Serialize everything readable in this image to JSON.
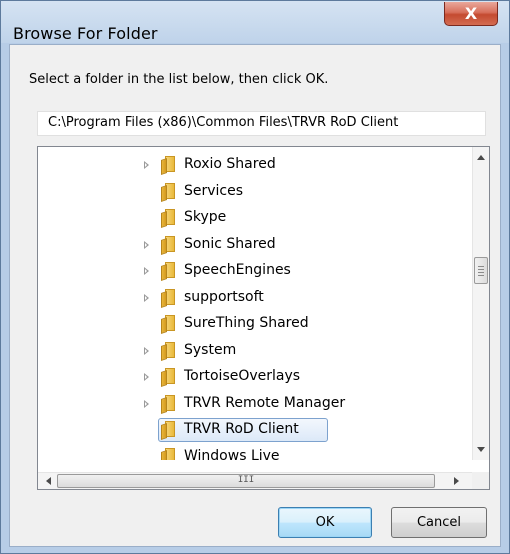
{
  "window": {
    "title": "Browse For Folder",
    "close_glyph": "X"
  },
  "instruction": "Select a folder in the list below, then click OK.",
  "path": "C:\\Program Files (x86)\\Common Files\\TRVR RoD Client",
  "tree": {
    "items": [
      {
        "label": "Roxio Shared",
        "expandable": true,
        "selected": false
      },
      {
        "label": "Services",
        "expandable": false,
        "selected": false
      },
      {
        "label": "Skype",
        "expandable": false,
        "selected": false
      },
      {
        "label": "Sonic Shared",
        "expandable": true,
        "selected": false
      },
      {
        "label": "SpeechEngines",
        "expandable": true,
        "selected": false
      },
      {
        "label": "supportsoft",
        "expandable": true,
        "selected": false
      },
      {
        "label": "SureThing Shared",
        "expandable": false,
        "selected": false
      },
      {
        "label": "System",
        "expandable": true,
        "selected": false
      },
      {
        "label": "TortoiseOverlays",
        "expandable": true,
        "selected": false
      },
      {
        "label": "TRVR Remote Manager",
        "expandable": true,
        "selected": false
      },
      {
        "label": "TRVR RoD Client",
        "expandable": false,
        "selected": true
      },
      {
        "label": "Windows Live",
        "expandable": false,
        "selected": false
      }
    ],
    "hscroll_thumb_grip": "III"
  },
  "buttons": {
    "ok": "OK",
    "cancel": "Cancel"
  },
  "icons": {
    "folder": "folder-icon",
    "expander": "expand-arrow-icon",
    "close": "close-icon"
  }
}
